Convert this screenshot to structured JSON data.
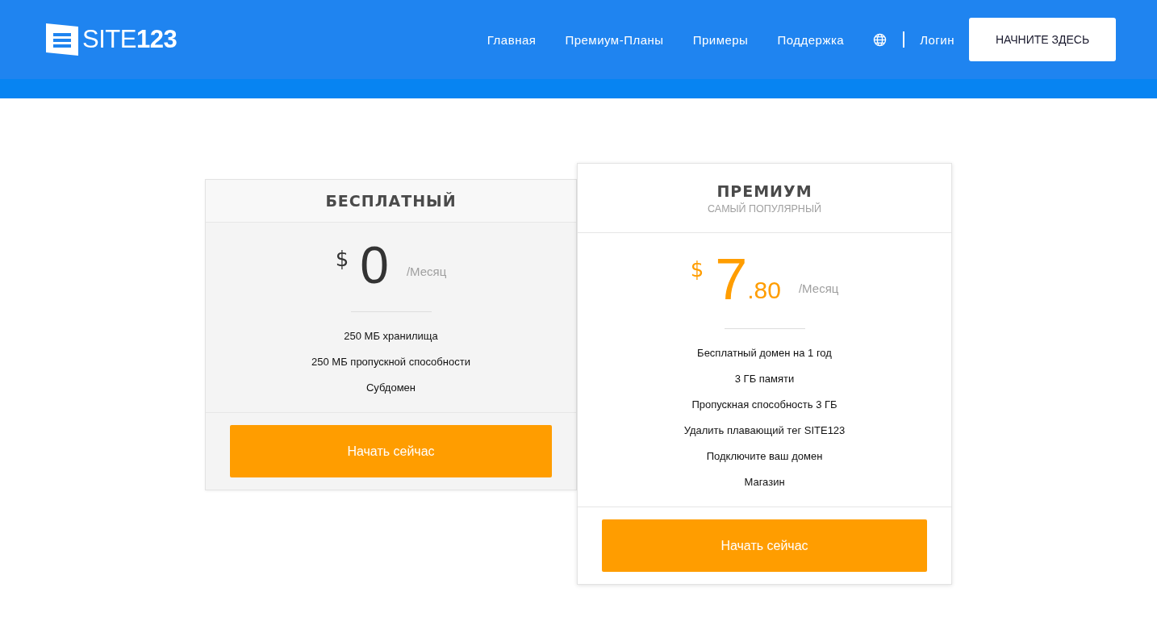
{
  "header": {
    "logo": "SITE**123**",
    "nav": [
      "Главная",
      "Премиум-Планы",
      "Примеры",
      "Поддержка"
    ],
    "login": "Логин",
    "cta": "НАЧНИТЕ ЗДЕСЬ"
  },
  "plans": [
    {
      "title": "БЕСПЛАТНЫЙ",
      "featured": false,
      "currency": "$",
      "amount": "0",
      "period": "/Месяц",
      "features": [
        "250 МБ хранилища",
        "250 МБ пропускной способности",
        "Субдомен"
      ],
      "button": "Начать сейчас"
    },
    {
      "title": "ПРЕМИУМ",
      "subtitle": "САМЫЙ ПОПУЛЯРНЫЙ",
      "featured": true,
      "currency": "$",
      "amount": "7",
      "cents": ".80",
      "period": "/Месяц",
      "features": [
        "Бесплатный домен на 1 год",
        "3 ГБ памяти",
        "Пропускная способность 3 ГБ",
        "Удалить плавающий тег SITE123",
        "Подключите ваш домен",
        "Магазин"
      ],
      "button": "Начать сейчас"
    }
  ]
}
